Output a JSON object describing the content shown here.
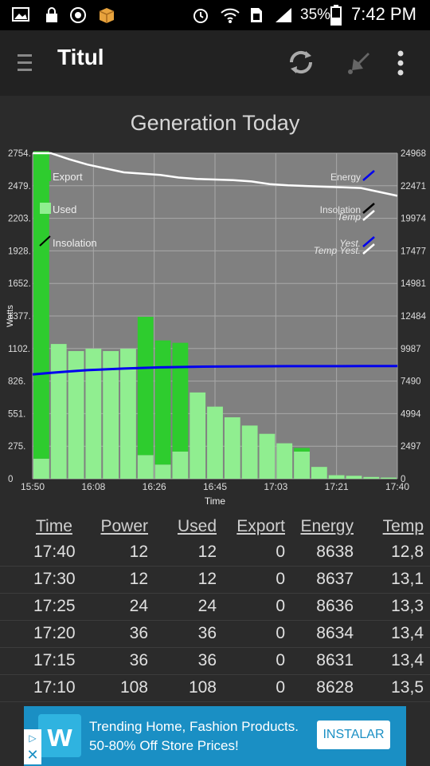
{
  "status_bar": {
    "battery": "35%",
    "time": "7:42 PM"
  },
  "app_bar": {
    "title": "Titul",
    "icons": [
      "menu-icon",
      "refresh-icon",
      "pin-icon",
      "overflow-icon"
    ]
  },
  "chart_title": "Generation Today",
  "chart_data": {
    "type": "bar",
    "title": "Generation Today",
    "xlabel": "Time",
    "ylabel": "Watts",
    "x_ticks": [
      "15:50",
      "16:08",
      "16:26",
      "16:45",
      "17:03",
      "17:21",
      "17:40"
    ],
    "y_ticks_left": [
      "0",
      "275.",
      "551.",
      "826.",
      "1102.",
      "1377.",
      "1652.",
      "1928.",
      "2203.",
      "2479.",
      "2754."
    ],
    "y_ticks_right": [
      "0",
      "2497",
      "4994",
      "7490",
      "9987",
      "12484",
      "14981",
      "17477",
      "19974",
      "22471",
      "24968"
    ],
    "ylim_left": [
      0,
      2754
    ],
    "ylim_right": [
      0,
      24968
    ],
    "legend_left": [
      "Export",
      "Used",
      "Insolation"
    ],
    "legend_right": [
      "Energy",
      "Insolation",
      "Temp",
      "Yest.",
      "Temp Yest."
    ],
    "series": [
      {
        "name": "Used",
        "values": [
          170,
          1140,
          1080,
          1100,
          1080,
          1100,
          200,
          120,
          230,
          730,
          610,
          520,
          450,
          380,
          300,
          230,
          100,
          30,
          25,
          15,
          10
        ]
      },
      {
        "name": "Export",
        "values": [
          2600,
          0,
          0,
          0,
          0,
          0,
          1170,
          1050,
          920,
          0,
          0,
          0,
          0,
          0,
          0,
          30,
          0,
          0,
          0,
          0,
          0
        ]
      },
      {
        "name": "Energy",
        "axis": "right",
        "values": [
          8000,
          8120,
          8230,
          8330,
          8390,
          8450,
          8500,
          8540,
          8570,
          8590,
          8605,
          8615,
          8622,
          8627,
          8632,
          8634,
          8636,
          8637,
          8638,
          8638,
          8638
        ]
      },
      {
        "name": "Temp",
        "axis": "right",
        "values": [
          24968,
          24968,
          24500,
          24100,
          23800,
          23500,
          23400,
          23300,
          23100,
          23000,
          22950,
          22900,
          22800,
          22600,
          22500,
          22450,
          22400,
          22350,
          22300,
          22000,
          21700
        ]
      }
    ],
    "colors": {
      "export": "#2ecc2e",
      "used": "#90ee90",
      "energy": "#0000ee",
      "temp": "#ffffff",
      "plot_bg": "#808080"
    }
  },
  "table": {
    "headers": [
      "Time",
      "Power",
      "Used",
      "Export",
      "Energy",
      "Temp"
    ],
    "rows": [
      [
        "17:40",
        "12",
        "12",
        "0",
        "8638",
        "12,8"
      ],
      [
        "17:30",
        "12",
        "12",
        "0",
        "8637",
        "13,1"
      ],
      [
        "17:25",
        "24",
        "24",
        "0",
        "8636",
        "13,3"
      ],
      [
        "17:20",
        "36",
        "36",
        "0",
        "8634",
        "13,4"
      ],
      [
        "17:15",
        "36",
        "36",
        "0",
        "8631",
        "13,4"
      ],
      [
        "17:10",
        "108",
        "108",
        "0",
        "8628",
        "13,5"
      ]
    ]
  },
  "ad": {
    "text": "Trending Home, Fashion Products. 50-80% Off Store Prices!",
    "button": "INSTALAR",
    "logo": "w"
  }
}
